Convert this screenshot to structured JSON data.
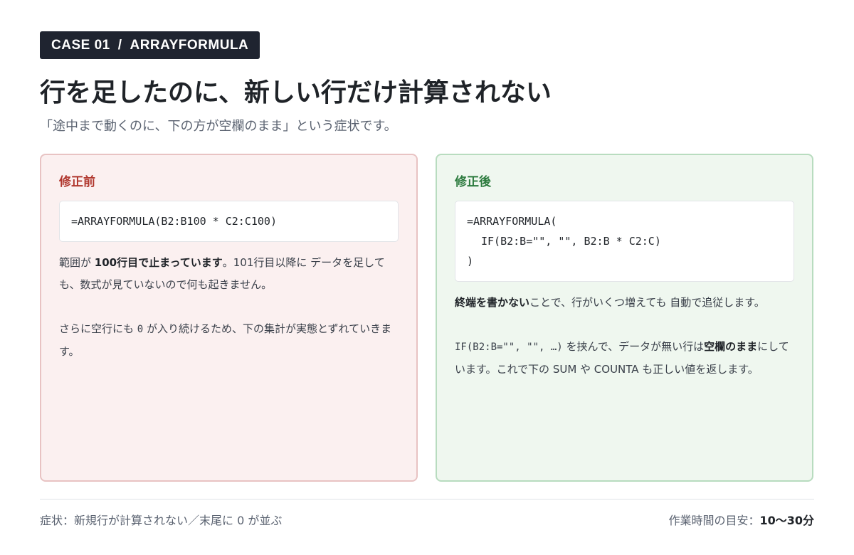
{
  "badge": {
    "case": "CASE 01",
    "separator": "/",
    "topic": "ARRAYFORMULA"
  },
  "title": "行を足したのに、新しい行だけ計算されない",
  "subtitle": "「途中まで動くのに、下の方が空欄のまま」という症状です。",
  "before": {
    "label": "修正前",
    "code": [
      "=ARRAYFORMULA(B2:B100 * C2:C100)"
    ],
    "p1": {
      "t1": "範囲が ",
      "b1": "100行目で止まっています",
      "t2": "。101行目以降に データを足しても、数式が見ていないので何も起きません。"
    },
    "p2": {
      "t1": "さらに空行にも ",
      "code": "0",
      "t2": " が入り続けるため、下の集計が実態とずれていきます。"
    }
  },
  "after": {
    "label": "修正後",
    "code": [
      "=ARRAYFORMULA(",
      "IF(B2:B=\"\", \"\", B2:B * C2:C)",
      ")"
    ],
    "p1": {
      "b1": "終端を書かない",
      "t1": "ことで、行がいくつ増えても 自動で追従します。"
    },
    "p2": {
      "code": "IF(B2:B=\"\", \"\", …)",
      "t1": " を挟んで、データが無い行は",
      "b1": "空欄のまま",
      "t2": "にしています。これで下の SUM や COUNTA も正しい値を返します。"
    }
  },
  "footer": {
    "symptom": "症状：新規行が計算されない／末尾に 0 が並ぶ",
    "time_label": "作業時間の目安：",
    "time_value": "10〜30分"
  }
}
